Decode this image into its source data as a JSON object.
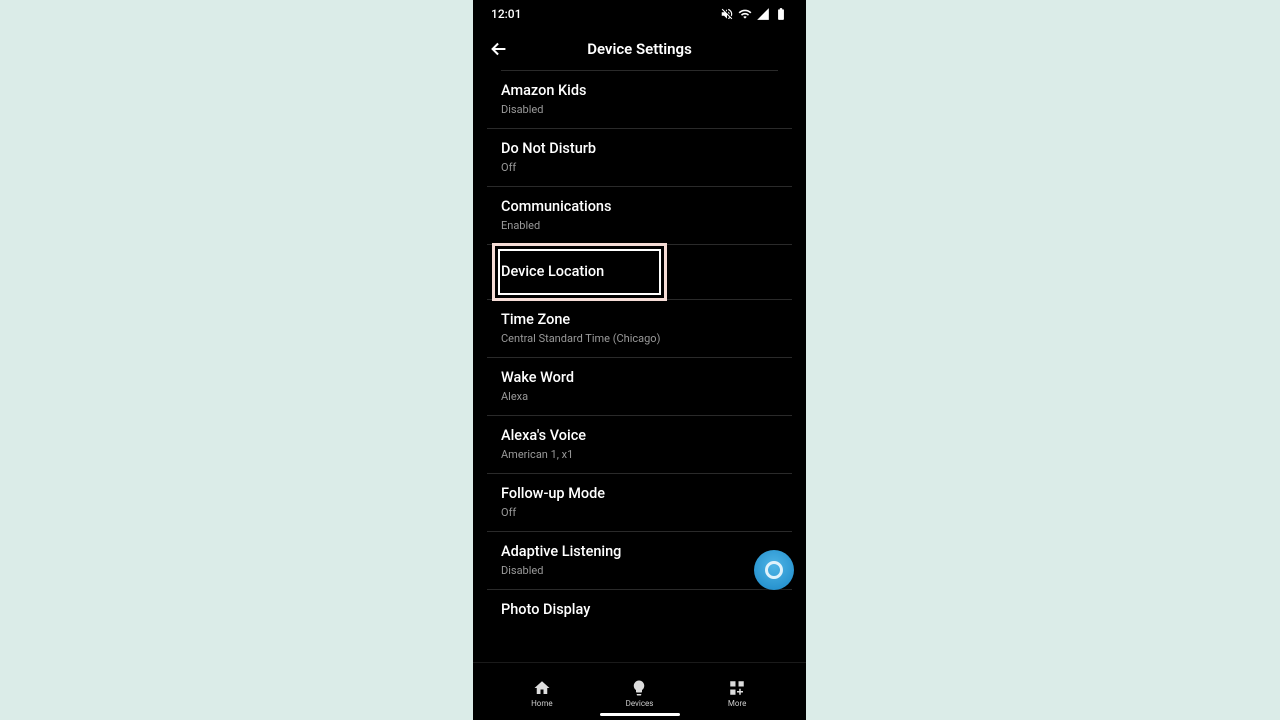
{
  "status": {
    "time": "12:01"
  },
  "header": {
    "title": "Device Settings"
  },
  "rows": [
    {
      "title": "Amazon Kids",
      "sub": "Disabled"
    },
    {
      "title": "Do Not Disturb",
      "sub": "Off"
    },
    {
      "title": "Communications",
      "sub": "Enabled"
    },
    {
      "title": "Device Location",
      "sub": ""
    },
    {
      "title": "Time Zone",
      "sub": "Central Standard Time (Chicago)"
    },
    {
      "title": "Wake Word",
      "sub": "Alexa"
    },
    {
      "title": "Alexa's Voice",
      "sub": "American 1, x1"
    },
    {
      "title": "Follow-up Mode",
      "sub": "Off"
    },
    {
      "title": "Adaptive Listening",
      "sub": "Disabled"
    },
    {
      "title": "Photo Display",
      "sub": ""
    }
  ],
  "nav": {
    "home": "Home",
    "devices": "Devices",
    "more": "More"
  }
}
